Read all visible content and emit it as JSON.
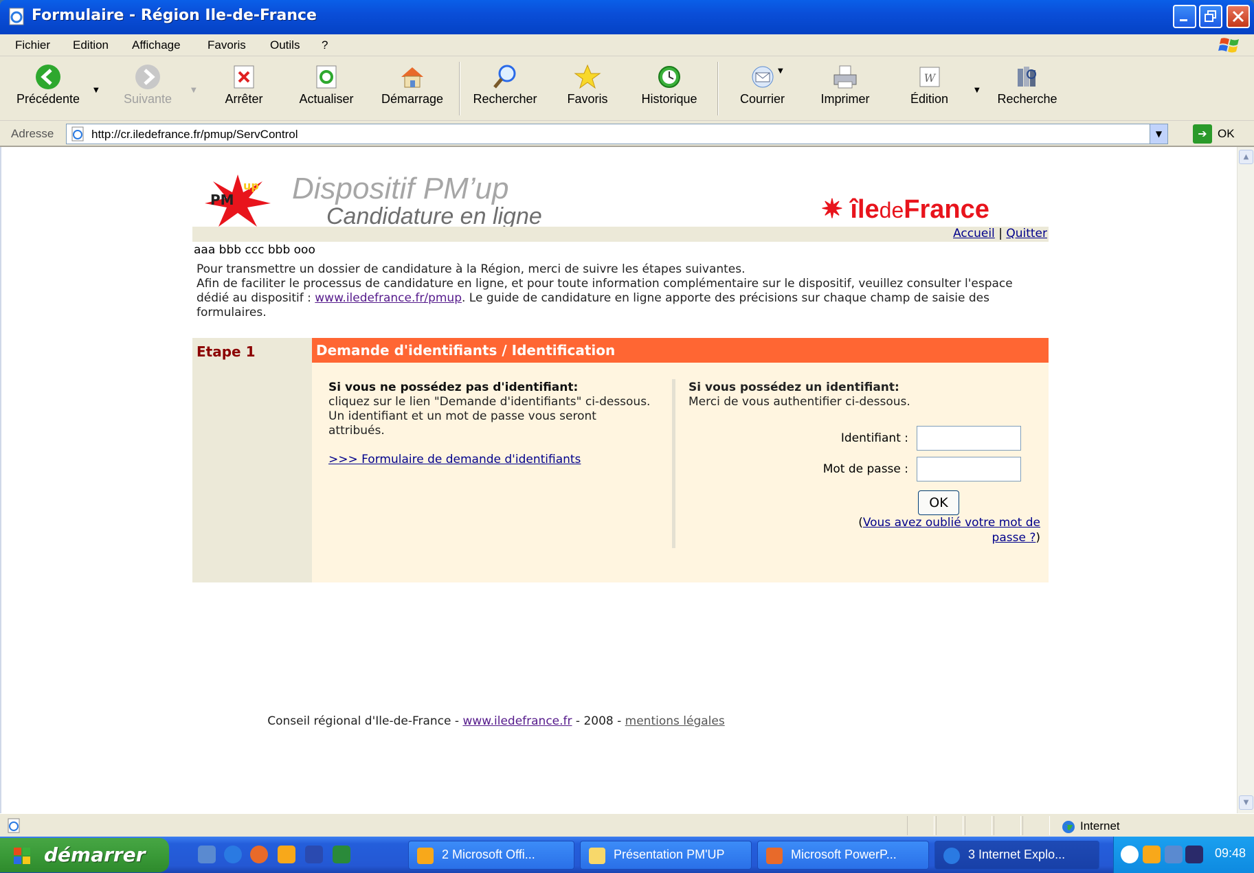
{
  "window": {
    "title": "Formulaire -  Région Ile-de-France"
  },
  "menu": [
    "Fichier",
    "Edition",
    "Affichage",
    "Favoris",
    "Outils",
    "?"
  ],
  "toolbar": {
    "back": "Précédente",
    "forward": "Suivante",
    "stop": "Arrêter",
    "refresh": "Actualiser",
    "home": "Démarrage",
    "search": "Rechercher",
    "favorites": "Favoris",
    "history": "Historique",
    "mail": "Courrier",
    "print": "Imprimer",
    "edit": "Édition",
    "research": "Recherche"
  },
  "address": {
    "label": "Adresse",
    "url": "http://cr.iledefrance.fr/pmup/ServControl",
    "go": "OK"
  },
  "header": {
    "pm_logo": "PM'up",
    "title1": "Dispositif PM’up",
    "title2": "Candidature en ligne",
    "brand_ile": "île",
    "brand_de": "de",
    "brand_france": "France",
    "nav_accueil": "Accueil",
    "nav_sep": "|",
    "nav_quitter": "Quitter"
  },
  "user": "aaa bbb ccc bbb ooo",
  "intro": {
    "line1": "Pour transmettre un dossier de candidature à la Région, merci de suivre les étapes suivantes.",
    "line2a": "Afin de faciliter le processus de candidature en ligne, et pour toute information complémentaire sur le dispositif, veuillez consulter l'espace dédié au dispositif : ",
    "link": "www.iledefrance.fr/pmup",
    "line2b": ". Le guide de candidature en ligne apporte des précisions sur chaque champ de saisie des formulaires."
  },
  "step": {
    "number": "Etape 1",
    "title": "Demande d'identifiants / Identification",
    "left_heading": "Si vous ne possédez pas d'identifiant:",
    "left_text1": "cliquez sur le lien \"Demande d'identifiants\" ci-dessous.",
    "left_text2": "Un identifiant et un mot de passe vous seront attribués.",
    "left_link": ">>> Formulaire de demande d'identifiants",
    "right_heading": "Si vous possédez un identifiant:",
    "right_text": "Merci de vous authentifier ci-dessous.",
    "id_label": "Identifiant :",
    "pw_label": "Mot de passe :",
    "ok": "OK",
    "forgot_open": "(",
    "forgot_link": "Vous avez oublié votre mot de passe ?",
    "forgot_close": ")"
  },
  "footer": {
    "prefix": "Conseil régional d'Ile-de-France - ",
    "link": "www.iledefrance.fr",
    "middle": " - 2008 - ",
    "legal": "mentions légales"
  },
  "statusbar": {
    "zone": "Internet"
  },
  "taskbar": {
    "start": "démarrer",
    "tasks": [
      "2 Microsoft Offi...",
      "Présentation PM'UP",
      "Microsoft PowerP...",
      "3 Internet Explo..."
    ],
    "clock": "09:48"
  }
}
